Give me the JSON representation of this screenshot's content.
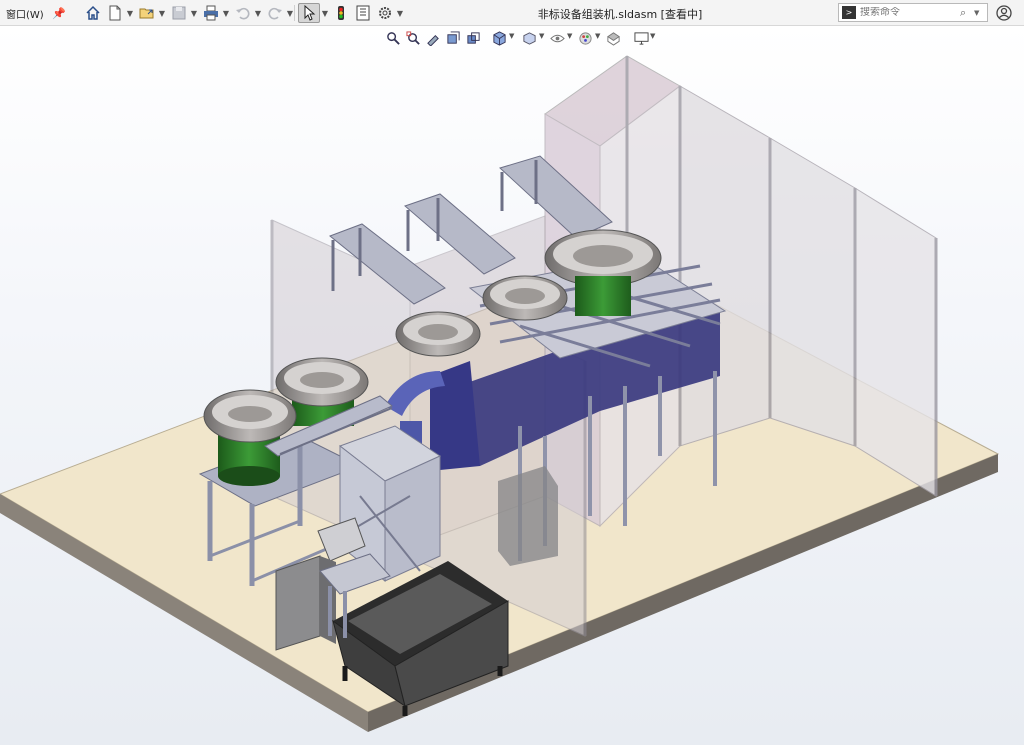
{
  "menu": {
    "window_label": "窗口(W)"
  },
  "document": {
    "title": "非标设备组装机.sldasm [查看中]"
  },
  "search": {
    "placeholder": "搜索命令"
  },
  "colors": {
    "floor": "#f1e6cb",
    "floor_edge": "#7f786f",
    "guard_glass": "#cbc7cf",
    "frame": "#9ba0b4",
    "bowl": "#9e9a98",
    "bowl_base": "#2f7a2b",
    "blue_panel": "#37377e",
    "bin": "#3d3d3d"
  }
}
